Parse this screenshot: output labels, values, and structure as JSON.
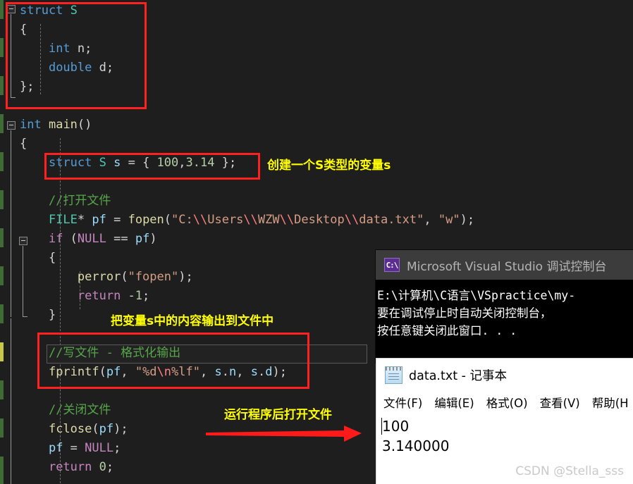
{
  "editor": {
    "background": "#1e1e1e",
    "lines": [
      {
        "indent": 0,
        "tokens": [
          {
            "t": "struct ",
            "c": "kw"
          },
          {
            "t": "S",
            "c": "typ"
          }
        ]
      },
      {
        "indent": 0,
        "tokens": [
          {
            "t": "{",
            "c": "pun"
          }
        ]
      },
      {
        "indent": 0,
        "tokens": [
          {
            "t": "    ",
            "c": "pun"
          },
          {
            "t": "int",
            "c": "kw"
          },
          {
            "t": " n;",
            "c": "pun"
          }
        ]
      },
      {
        "indent": 0,
        "tokens": [
          {
            "t": "    ",
            "c": "pun"
          },
          {
            "t": "double",
            "c": "kw"
          },
          {
            "t": " d;",
            "c": "pun"
          }
        ]
      },
      {
        "indent": 0,
        "tokens": [
          {
            "t": "};",
            "c": "pun"
          }
        ]
      },
      {
        "indent": 0,
        "tokens": [
          {
            "t": "",
            "c": "pun"
          }
        ]
      },
      {
        "indent": 0,
        "tokens": [
          {
            "t": "int",
            "c": "kw"
          },
          {
            "t": " ",
            "c": "pun"
          },
          {
            "t": "main",
            "c": "fn"
          },
          {
            "t": "()",
            "c": "pun"
          }
        ]
      },
      {
        "indent": 0,
        "tokens": [
          {
            "t": "{",
            "c": "pun"
          }
        ]
      },
      {
        "indent": 0,
        "tokens": [
          {
            "t": "    ",
            "c": "pun"
          },
          {
            "t": "struct ",
            "c": "kw"
          },
          {
            "t": "S",
            "c": "typ"
          },
          {
            "t": " ",
            "c": "pun"
          },
          {
            "t": "s",
            "c": "var"
          },
          {
            "t": " = { ",
            "c": "pun"
          },
          {
            "t": "100",
            "c": "num"
          },
          {
            "t": ",",
            "c": "pun"
          },
          {
            "t": "3.14",
            "c": "num"
          },
          {
            "t": " };",
            "c": "pun"
          }
        ]
      },
      {
        "indent": 0,
        "tokens": [
          {
            "t": "",
            "c": "pun"
          }
        ]
      },
      {
        "indent": 0,
        "tokens": [
          {
            "t": "    ",
            "c": "pun"
          },
          {
            "t": "//打开文件",
            "c": "cmt"
          }
        ]
      },
      {
        "indent": 0,
        "tokens": [
          {
            "t": "    ",
            "c": "pun"
          },
          {
            "t": "FILE",
            "c": "typ"
          },
          {
            "t": "* ",
            "c": "pun"
          },
          {
            "t": "pf",
            "c": "var"
          },
          {
            "t": " = ",
            "c": "pun"
          },
          {
            "t": "fopen",
            "c": "fn"
          },
          {
            "t": "(",
            "c": "pun"
          },
          {
            "t": "\"C:",
            "c": "str"
          },
          {
            "t": "\\\\",
            "c": "esc"
          },
          {
            "t": "Users",
            "c": "str"
          },
          {
            "t": "\\\\",
            "c": "esc"
          },
          {
            "t": "WZW",
            "c": "str"
          },
          {
            "t": "\\\\",
            "c": "esc"
          },
          {
            "t": "Desktop",
            "c": "str"
          },
          {
            "t": "\\\\",
            "c": "esc"
          },
          {
            "t": "data.txt\"",
            "c": "str"
          },
          {
            "t": ", ",
            "c": "pun"
          },
          {
            "t": "\"w\"",
            "c": "str"
          },
          {
            "t": ");",
            "c": "pun"
          }
        ]
      },
      {
        "indent": 0,
        "tokens": [
          {
            "t": "    ",
            "c": "pun"
          },
          {
            "t": "if",
            "c": "mac"
          },
          {
            "t": " (",
            "c": "pun"
          },
          {
            "t": "NULL",
            "c": "mac"
          },
          {
            "t": " == ",
            "c": "pun"
          },
          {
            "t": "pf",
            "c": "var"
          },
          {
            "t": ")",
            "c": "pun"
          }
        ]
      },
      {
        "indent": 0,
        "tokens": [
          {
            "t": "    {",
            "c": "pun"
          }
        ]
      },
      {
        "indent": 0,
        "tokens": [
          {
            "t": "        ",
            "c": "pun"
          },
          {
            "t": "perror",
            "c": "fn"
          },
          {
            "t": "(",
            "c": "pun"
          },
          {
            "t": "\"fopen\"",
            "c": "str"
          },
          {
            "t": ");",
            "c": "pun"
          }
        ]
      },
      {
        "indent": 0,
        "tokens": [
          {
            "t": "        ",
            "c": "pun"
          },
          {
            "t": "return",
            "c": "mac"
          },
          {
            "t": " -",
            "c": "pun"
          },
          {
            "t": "1",
            "c": "num"
          },
          {
            "t": ";",
            "c": "pun"
          }
        ]
      },
      {
        "indent": 0,
        "tokens": [
          {
            "t": "    }",
            "c": "pun"
          }
        ]
      },
      {
        "indent": 0,
        "tokens": [
          {
            "t": "",
            "c": "pun"
          }
        ]
      },
      {
        "indent": 0,
        "tokens": [
          {
            "t": "    ",
            "c": "pun"
          },
          {
            "t": "//写文件 - 格式化输出",
            "c": "cmt"
          }
        ]
      },
      {
        "indent": 0,
        "tokens": [
          {
            "t": "    ",
            "c": "pun"
          },
          {
            "t": "fprintf",
            "c": "fn"
          },
          {
            "t": "(",
            "c": "pun"
          },
          {
            "t": "pf",
            "c": "var"
          },
          {
            "t": ", ",
            "c": "pun"
          },
          {
            "t": "\"%d",
            "c": "str"
          },
          {
            "t": "\\n",
            "c": "esc"
          },
          {
            "t": "%lf\"",
            "c": "str"
          },
          {
            "t": ", ",
            "c": "pun"
          },
          {
            "t": "s",
            "c": "var"
          },
          {
            "t": ".",
            "c": "pun"
          },
          {
            "t": "n",
            "c": "var"
          },
          {
            "t": ", ",
            "c": "pun"
          },
          {
            "t": "s",
            "c": "var"
          },
          {
            "t": ".",
            "c": "pun"
          },
          {
            "t": "d",
            "c": "var"
          },
          {
            "t": ");",
            "c": "pun"
          }
        ]
      },
      {
        "indent": 0,
        "tokens": [
          {
            "t": "",
            "c": "pun"
          }
        ]
      },
      {
        "indent": 0,
        "tokens": [
          {
            "t": "    ",
            "c": "pun"
          },
          {
            "t": "//关闭文件",
            "c": "cmt"
          }
        ]
      },
      {
        "indent": 0,
        "tokens": [
          {
            "t": "    ",
            "c": "pun"
          },
          {
            "t": "fclose",
            "c": "fn"
          },
          {
            "t": "(",
            "c": "pun"
          },
          {
            "t": "pf",
            "c": "var"
          },
          {
            "t": ");",
            "c": "pun"
          }
        ]
      },
      {
        "indent": 0,
        "tokens": [
          {
            "t": "    ",
            "c": "pun"
          },
          {
            "t": "pf",
            "c": "var"
          },
          {
            "t": " = ",
            "c": "pun"
          },
          {
            "t": "NULL",
            "c": "mac"
          },
          {
            "t": ";",
            "c": "pun"
          }
        ]
      },
      {
        "indent": 0,
        "tokens": [
          {
            "t": "    ",
            "c": "pun"
          },
          {
            "t": "return",
            "c": "mac"
          },
          {
            "t": " ",
            "c": "pun"
          },
          {
            "t": "0",
            "c": "num"
          },
          {
            "t": ";",
            "c": "pun"
          }
        ]
      }
    ]
  },
  "annotations": {
    "note_create_variable": "创建一个S类型的变量s",
    "note_output_to_file": "把变量s中的内容输出到文件中",
    "note_open_file_after_run": "运行程序后打开文件",
    "highlight_color": "#ff2020",
    "note_color": "#ffff00"
  },
  "console_window": {
    "icon": "console-icon",
    "title": "Microsoft Visual Studio 调试控制台",
    "lines": [
      "E:\\计算机\\C语言\\VSpractice\\my-",
      "要在调试停止时自动关闭控制台，",
      "按任意键关闭此窗口. . ."
    ]
  },
  "notepad_window": {
    "icon": "notepad-icon",
    "title": "data.txt - 记事本",
    "menu": [
      "文件(F)",
      "编辑(E)",
      "格式(O)",
      "查看(V)",
      "帮助(H"
    ],
    "content_lines": [
      "100",
      "3.140000"
    ],
    "watermark": "CSDN @Stella_sss"
  }
}
